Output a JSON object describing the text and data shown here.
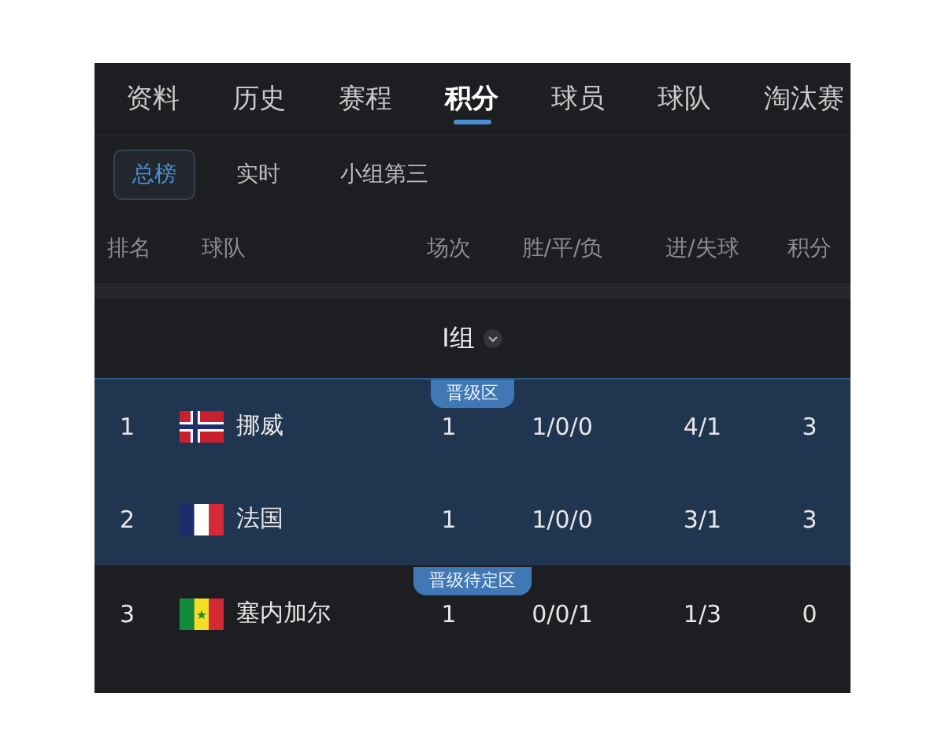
{
  "tabs": [
    {
      "label": "资料",
      "selected": false
    },
    {
      "label": "历史",
      "selected": false
    },
    {
      "label": "赛程",
      "selected": false
    },
    {
      "label": "积分",
      "selected": true
    },
    {
      "label": "球员",
      "selected": false
    },
    {
      "label": "球队",
      "selected": false
    },
    {
      "label": "淘汰赛",
      "selected": false
    }
  ],
  "subtabs": [
    {
      "label": "总榜",
      "selected": true
    },
    {
      "label": "实时",
      "selected": false
    },
    {
      "label": "小组第三",
      "selected": false
    }
  ],
  "columns": [
    "排名",
    "球队",
    "场次",
    "胜/平/负",
    "进/失球",
    "积分"
  ],
  "group": {
    "label": "I组"
  },
  "zones": [
    {
      "label": "晋级区",
      "highlight": true,
      "rows": [
        {
          "rank": "1",
          "kind": "norway",
          "team": "挪威",
          "played": "1",
          "wdl": "1/0/0",
          "goals": "4/1",
          "points": "3"
        },
        {
          "rank": "2",
          "kind": "france",
          "team": "法国",
          "played": "1",
          "wdl": "1/0/0",
          "goals": "3/1",
          "points": "3"
        }
      ]
    },
    {
      "label": "晋级待定区",
      "highlight": false,
      "rows": [
        {
          "rank": "3",
          "kind": "senegal",
          "team": "塞内加尔",
          "played": "1",
          "wdl": "0/0/1",
          "goals": "1/3",
          "points": "0"
        }
      ]
    }
  ]
}
